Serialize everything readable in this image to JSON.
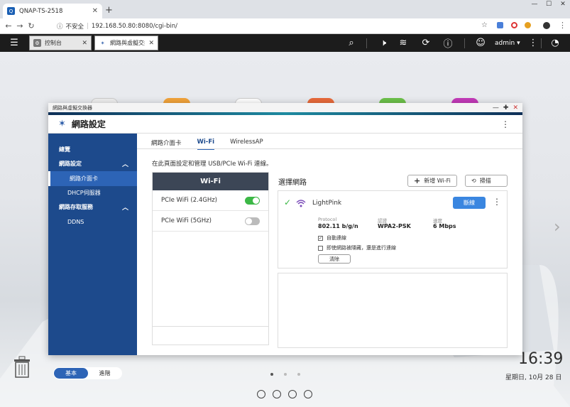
{
  "browser": {
    "tab_title": "QNAP-TS-2518",
    "security_label": "不安全",
    "url": "192.168.50.80:8080/cgi-bin/"
  },
  "qts": {
    "tabs": [
      {
        "label": "控制台"
      },
      {
        "label": "網路與虛擬交換..."
      }
    ],
    "user": "admin"
  },
  "desktop": {
    "time": "16:39",
    "date": "星期日, 10月 28 日"
  },
  "window": {
    "title_bar": "網路與虛擬交換器",
    "header": "網路設定",
    "sidebar": [
      {
        "label": "總覽"
      },
      {
        "label": "網路設定"
      },
      {
        "label": "網路介面卡"
      },
      {
        "label": "DHCP伺服器"
      },
      {
        "label": "網路存取服務"
      },
      {
        "label": "DDNS"
      }
    ],
    "mode": {
      "basic": "基本",
      "advanced": "進階"
    },
    "tabs": [
      {
        "label": "網路介面卡"
      },
      {
        "label": "Wi-Fi"
      },
      {
        "label": "WirelessAP"
      }
    ],
    "intro": "在此頁面設定和管理 USB/PCIe Wi-Fi 連線。",
    "panel_title": "Wi-Fi",
    "adapters": [
      {
        "label": "PCIe WiFi (2.4GHz)",
        "enabled": true
      },
      {
        "label": "PCIe WiFi (5GHz)",
        "enabled": false
      }
    ],
    "select_network": "選擇網路",
    "add_wifi": "新增 Wi-Fi",
    "scan": "掃描",
    "network": {
      "ssid": "LightPink",
      "disconnect": "斷線",
      "protocol_label": "Protocol",
      "protocol": "802.11 b/g/n",
      "auth_label": "認證",
      "auth": "WPA2-PSK",
      "speed_label": "速度",
      "speed": "6 Mbps",
      "auto_connect": "自動連線",
      "hidden_connect": "即使網路被隱藏，還是進行連線",
      "clear": "清除"
    }
  },
  "colors": {
    "accent": "#2d64b6",
    "sidebar": "#1d4a8c",
    "toggle_on": "#3cb846"
  }
}
